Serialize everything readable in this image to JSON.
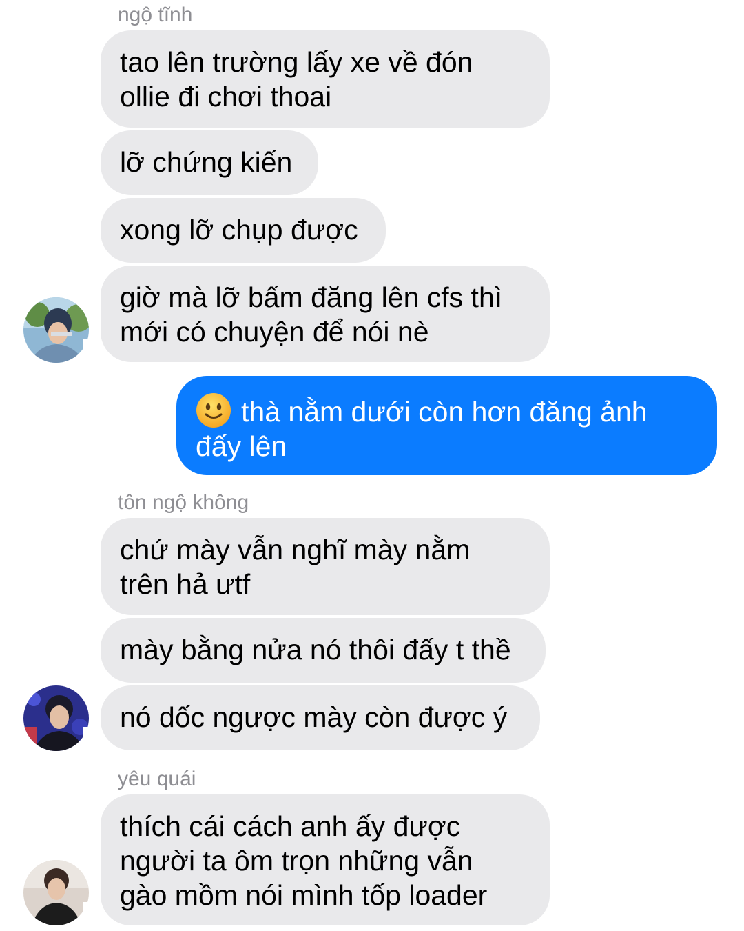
{
  "conversation": {
    "group1": {
      "sender": "ngộ tĩnh",
      "messages": [
        [
          "tao lên trường lấy xe về đón",
          "ollie đi chơi thoai"
        ],
        [
          "lỡ chứng kiến"
        ],
        [
          "xong lỡ chụp được"
        ],
        [
          "giờ mà lỡ bấm đăng lên cfs thì",
          "mới có chuyện để nói nè"
        ]
      ]
    },
    "outgoing": {
      "emoji": "slightly-smiling-face-icon",
      "lines": [
        "thà nằm dưới còn hơn đăng ảnh",
        "đấy lên"
      ]
    },
    "group2": {
      "sender": "tôn ngộ không",
      "messages": [
        [
          "chứ mày vẫn nghĩ mày nằm",
          "trên hả ưtf"
        ],
        [
          "mày bằng nửa nó thôi đấy t thề"
        ],
        [
          "nó dốc ngược mày còn được ý"
        ]
      ]
    },
    "group3": {
      "sender": "yêu quái",
      "messages": [
        [
          "thích cái cách anh ấy được",
          "người ta ôm trọn những vẫn",
          "gào mồm nói mình tốp loader"
        ]
      ]
    }
  },
  "colors": {
    "incoming_bubble": "#e9e9eb",
    "outgoing_bubble": "#0b7cff",
    "sender_name": "#8e8e93"
  }
}
